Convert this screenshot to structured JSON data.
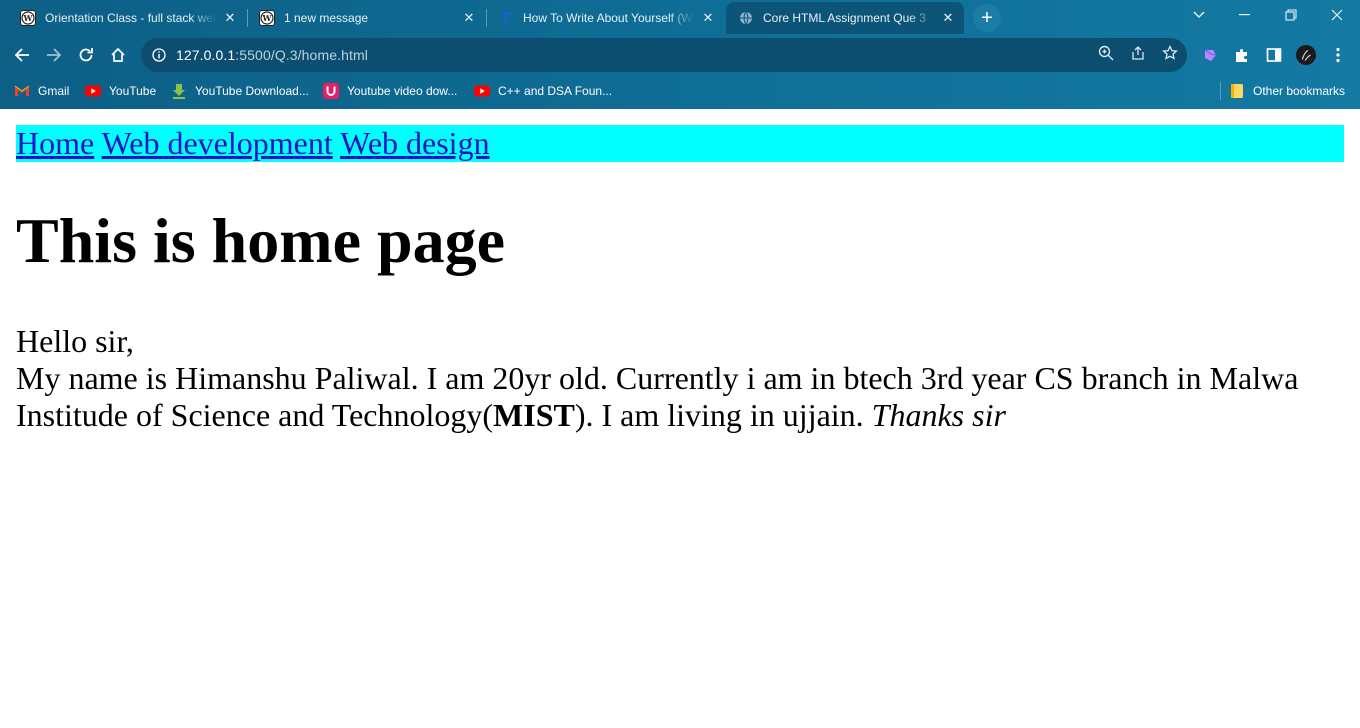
{
  "browser": {
    "tabs": [
      {
        "title": "Orientation Class - full stack web",
        "favicon": "wordpress-icon",
        "active": false
      },
      {
        "title": "1 new message",
        "favicon": "wordpress-icon",
        "active": false
      },
      {
        "title": "How To Write About Yourself (Wi",
        "favicon": "tw-icon",
        "active": false
      },
      {
        "title": "Core HTML Assignment Que 3",
        "favicon": "globe-icon",
        "active": true
      }
    ],
    "new_tab_label": "+",
    "address": {
      "host": "127.0.0.1",
      "rest": ":5500/Q.3/home.html"
    },
    "bookmarks": [
      {
        "label": "Gmail",
        "icon": "gmail-icon"
      },
      {
        "label": "YouTube",
        "icon": "youtube-icon"
      },
      {
        "label": "YouTube Download...",
        "icon": "download-icon"
      },
      {
        "label": "Youtube video dow...",
        "icon": "u-icon"
      },
      {
        "label": "C++ and DSA Foun...",
        "icon": "youtube-icon"
      }
    ],
    "other_bookmarks": "Other bookmarks",
    "colors": {
      "frame": "#0f6f97",
      "omnibox": "#0b4e70",
      "active_tab": "#0d5578"
    }
  },
  "page": {
    "nav": {
      "home": "Home",
      "web_development": "Web development",
      "web_design": "Web design",
      "background": "#00ffff"
    },
    "heading": "This is home page",
    "greeting": "Hello sir,",
    "para_part1": "My name is Himanshu Paliwal. I am 20yr old. Currently i am in btech 3rd year CS branch in Malwa Institude of Science and Technology(",
    "para_bold": "MIST",
    "para_part2": "). I am living in ujjain. ",
    "para_italic": "Thanks sir"
  }
}
